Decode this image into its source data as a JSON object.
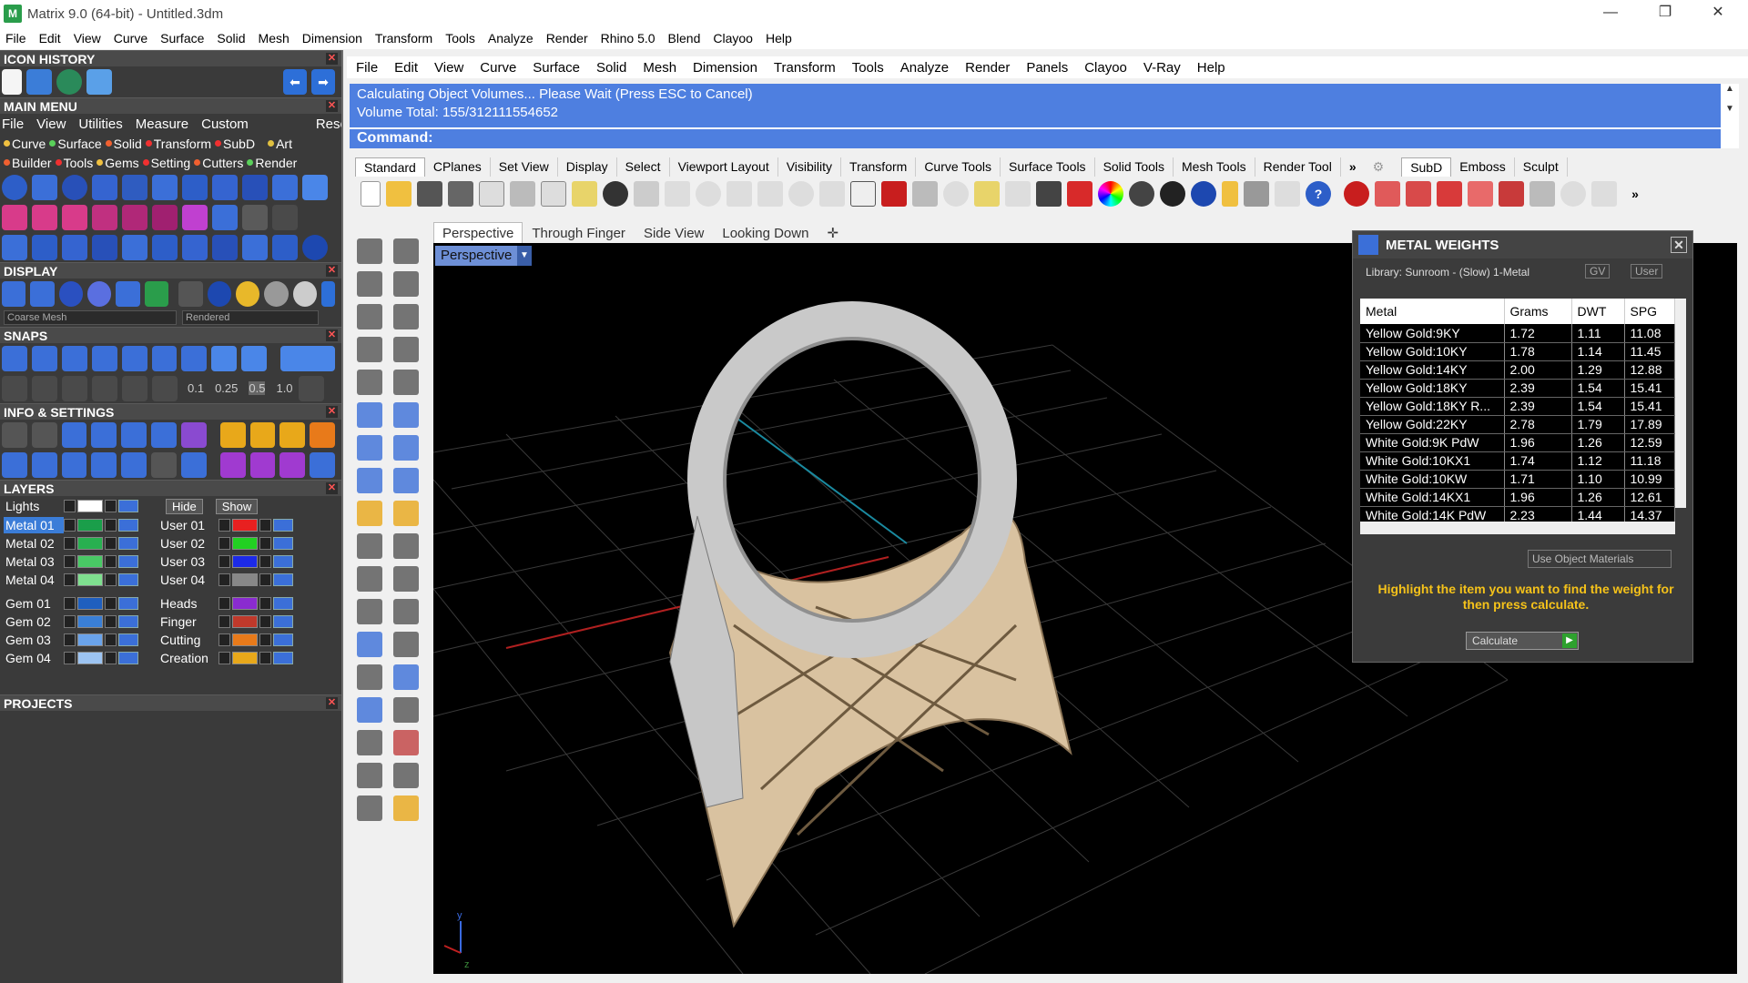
{
  "window": {
    "title": "Matrix 9.0 (64-bit) - Untitled.3dm",
    "controls": [
      "—",
      "❐",
      "✕"
    ]
  },
  "top_menu": [
    "File",
    "Edit",
    "View",
    "Curve",
    "Surface",
    "Solid",
    "Mesh",
    "Dimension",
    "Transform",
    "Tools",
    "Analyze",
    "Render",
    "Rhino 5.0",
    "Blend",
    "Clayoo",
    "Help"
  ],
  "left_panel": {
    "icon_history": "ICON HISTORY",
    "main_menu": "MAIN MENU",
    "main_menu_items": [
      "File",
      "View",
      "Utilities",
      "Measure",
      "Custom",
      "Reset"
    ],
    "tags_row1": [
      "Curve",
      "Surface",
      "Solid",
      "Transform",
      "SubD",
      "Art"
    ],
    "tags_row2": [
      "Builder",
      "Tools",
      "Gems",
      "Setting",
      "Cutters",
      "Render"
    ],
    "display": "DISPLAY",
    "display_mesh": "Coarse Mesh",
    "display_mode": "Rendered",
    "snaps": "SNAPS",
    "snap_values": [
      "0.1",
      "0.25",
      "0.5",
      "1.0"
    ],
    "info_settings": "INFO & SETTINGS",
    "layers": "LAYERS",
    "lights": "Lights",
    "hide": "Hide",
    "show": "Show",
    "layers_left": [
      "Metal 01",
      "Metal 02",
      "Metal 03",
      "Metal 04",
      "Gem 01",
      "Gem 02",
      "Gem 03",
      "Gem 04"
    ],
    "layers_right": [
      "User 01",
      "User 02",
      "User 03",
      "User 04",
      "Heads",
      "Finger",
      "Cutting",
      "Creation"
    ],
    "layer_colors_left": [
      "#1a9e4a",
      "#28b050",
      "#49c965",
      "#7fe08f",
      "#1f5fbf",
      "#3a7fd6",
      "#6aa3ea",
      "#9dc4f2"
    ],
    "layer_colors_right": [
      "#e82020",
      "#22d022",
      "#1c2ae8",
      "#888888",
      "#8a2bd0",
      "#c0392b",
      "#e87a1a",
      "#e8a81a"
    ],
    "projects": "PROJECTS"
  },
  "main_menu": [
    "File",
    "Edit",
    "View",
    "Curve",
    "Surface",
    "Solid",
    "Mesh",
    "Dimension",
    "Transform",
    "Tools",
    "Analyze",
    "Render",
    "Panels",
    "Clayoo",
    "V-Ray",
    "Help"
  ],
  "command": {
    "line1": "Calculating Object Volumes... Please Wait (Press ESC to Cancel)",
    "line2": "Volume Total: 155/312111554652",
    "prompt": "Command:"
  },
  "toolbar_tabs": [
    "Standard",
    "CPlanes",
    "Set View",
    "Display",
    "Select",
    "Viewport Layout",
    "Visibility",
    "Transform",
    "Curve Tools",
    "Surface Tools",
    "Solid Tools",
    "Mesh Tools",
    "Render Tool"
  ],
  "toolbar_tabs_right": [
    "SubD",
    "Emboss",
    "Sculpt"
  ],
  "viewport_tabs": [
    "Perspective",
    "Through Finger",
    "Side View",
    "Looking Down"
  ],
  "viewport_label": "Perspective",
  "axis_labels": {
    "y": "y",
    "z": "z"
  },
  "metal_weights": {
    "title": "METAL WEIGHTS",
    "library": "Library: Sunroom - (Slow) 1-Metal",
    "gv": "GV",
    "user": "User",
    "columns": [
      "Metal",
      "Grams",
      "DWT",
      "SPG"
    ],
    "rows": [
      [
        "Yellow Gold:9KY",
        "1.72",
        "1.11",
        "11.08"
      ],
      [
        "Yellow Gold:10KY",
        "1.78",
        "1.14",
        "11.45"
      ],
      [
        "Yellow Gold:14KY",
        "2.00",
        "1.29",
        "12.88"
      ],
      [
        "Yellow Gold:18KY",
        "2.39",
        "1.54",
        "15.41"
      ],
      [
        "Yellow Gold:18KY R...",
        "2.39",
        "1.54",
        "15.41"
      ],
      [
        "Yellow Gold:22KY",
        "2.78",
        "1.79",
        "17.89"
      ],
      [
        "White Gold:9K PdW",
        "1.96",
        "1.26",
        "12.59"
      ],
      [
        "White Gold:10KX1",
        "1.74",
        "1.12",
        "11.18"
      ],
      [
        "White Gold:10KW",
        "1.71",
        "1.10",
        "10.99"
      ],
      [
        "White Gold:14KX1",
        "1.96",
        "1.26",
        "12.61"
      ],
      [
        "White Gold:14K PdW",
        "2.23",
        "1.44",
        "14.37"
      ]
    ],
    "use_materials": "Use Object Materials",
    "note": "Highlight the item you want to find the weight for then press calculate.",
    "calculate": "Calculate"
  }
}
